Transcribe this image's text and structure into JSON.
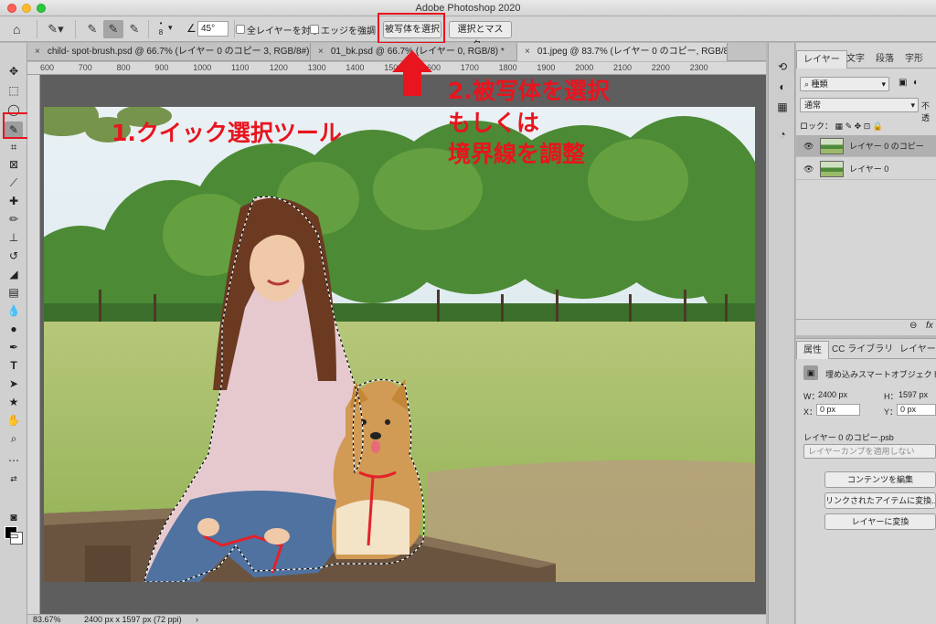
{
  "window": {
    "title": "Adobe Photoshop 2020"
  },
  "options_bar": {
    "brush_size": "8",
    "angle_value": "45°",
    "sample_all_layers_label": "全レイヤーを対象",
    "enhance_edge_label": "エッジを強調",
    "select_subject_label": "被写体を選択",
    "select_and_mask_label": "選択とマスク..."
  },
  "tabs": [
    {
      "label": "child- spot-brush.psd @ 66.7% (レイヤー 0 のコピー 3, RGB/8#)"
    },
    {
      "label": "01_bk.psd @ 66.7% (レイヤー 0, RGB/8) *"
    },
    {
      "label": "01.jpeg @ 83.7% (レイヤー 0 のコピー, RGB/8) *"
    }
  ],
  "ruler": {
    "ticks": [
      "600",
      "700",
      "800",
      "900",
      "1000",
      "1100",
      "1200",
      "1300",
      "1400",
      "1500",
      "1600",
      "1700",
      "1800",
      "1900",
      "2000",
      "2100",
      "2200",
      "2300"
    ]
  },
  "status": {
    "zoom": "83.67%",
    "doc_info": "2400 px x 1597 px (72 ppi)"
  },
  "annotations": {
    "step1": "1.クイック選択ツール",
    "step2_line1": "2.被写体を選択",
    "step2_line2": "もしくは",
    "step2_line3": "境界線を調整"
  },
  "layers_panel": {
    "tabs": [
      "レイヤー",
      "文字",
      "段落",
      "字形"
    ],
    "filter_label": "種類",
    "blend_mode": "通常",
    "opacity_label": "不透",
    "lock_label": "ロック：",
    "layers": [
      {
        "name": "レイヤー 0 のコピー",
        "selected": true
      },
      {
        "name": "レイヤー 0",
        "selected": false
      }
    ],
    "footer_fx": "fx"
  },
  "properties_panel": {
    "tabs": [
      "属性",
      "CC ライブラリ",
      "レイヤーカ"
    ],
    "type_label": "埋め込みスマートオブジェクト",
    "w_label": "W：",
    "w_value": "2400 px",
    "h_label": "H：",
    "h_value": "1597 px",
    "x_label": "X：",
    "x_value": "0 px",
    "y_label": "Y：",
    "y_value": "0 px",
    "file_name": "レイヤー 0 のコピー.psb",
    "layer_comp_placeholder": "レイヤーカンプを適用しない",
    "edit_contents_label": "コンテンツを編集",
    "relink_label": "リンクされたアイテムに変換...",
    "convert_label": "レイヤーに変換"
  },
  "colors": {
    "annotation_red": "#e8141e",
    "panel_bg": "#d6d6d6",
    "pasteboard": "#5e5e5e"
  }
}
